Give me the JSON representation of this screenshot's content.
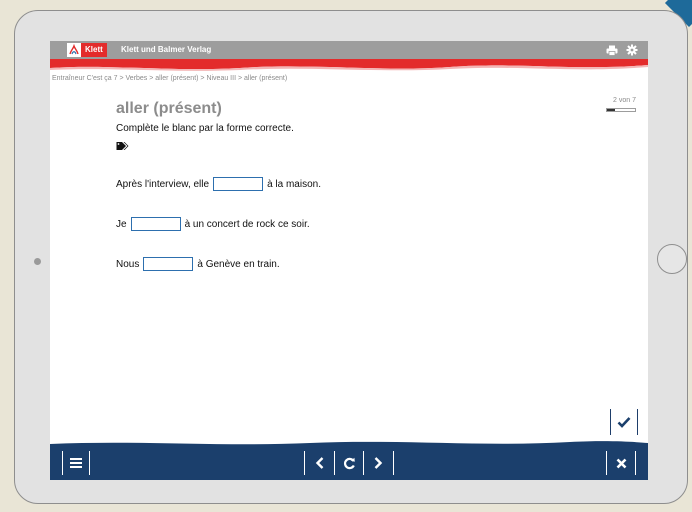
{
  "topbar": {
    "logo_text": "Klett",
    "publisher": "Klett und Balmer Verlag",
    "icons": [
      "printer-icon",
      "gear-icon"
    ]
  },
  "breadcrumb": "Entraîneur C'est ça 7 > Verbes > aller (présent) > Niveau III > aller (présent)",
  "exercise": {
    "title": "aller (présent)",
    "counter": "2 von 7",
    "progress": 0.29,
    "instruction": "Complète le blanc par la forme correcte.",
    "tag_icon": "tag-icon",
    "sentences": [
      {
        "before": "Après l'interview, elle",
        "after": "à la maison.",
        "value": ""
      },
      {
        "before": "Je",
        "after": "à un concert de rock ce soir.",
        "value": ""
      },
      {
        "before": "Nous",
        "after": "à Genève en train.",
        "value": ""
      }
    ]
  },
  "colors": {
    "accent_red": "#e32b2b",
    "navy": "#1b3f6c",
    "input_border": "#2d6fae",
    "topbar_gray": "#9d9d9d"
  },
  "bottombar": {
    "icons": [
      "menu-icon",
      "chevron-left-icon",
      "refresh-icon",
      "chevron-right-icon",
      "close-icon"
    ]
  }
}
